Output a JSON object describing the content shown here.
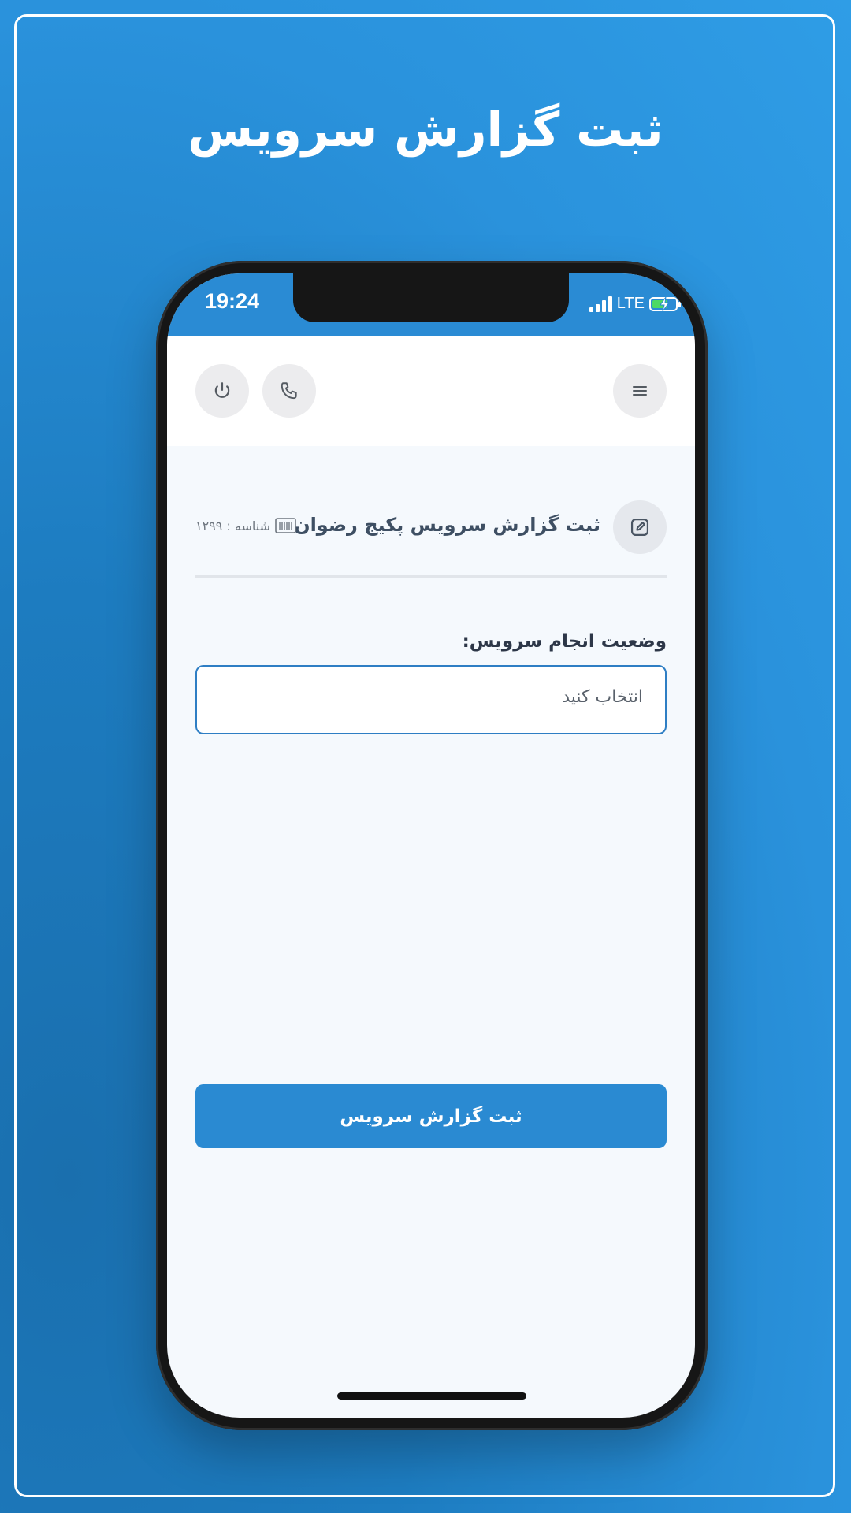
{
  "promo": {
    "title": "ثبت گزارش سرویس"
  },
  "status_bar": {
    "time": "19:24",
    "network": "LTE",
    "icons": [
      "signal-icon",
      "battery-charging-icon"
    ]
  },
  "header": {
    "buttons": [
      "power-icon",
      "phone-icon",
      "menu-icon"
    ]
  },
  "report": {
    "title": "ثبت گزارش سرویس پکیج رضوان",
    "id_text": "شناسه : ۱۲۹۹",
    "icons": [
      "edit-icon",
      "barcode-icon"
    ]
  },
  "form": {
    "status_label": "وضعیت انجام سرویس:",
    "status_value": "انتخاب کنید",
    "submit_label": "ثبت گزارش سرویس"
  },
  "colors": {
    "background": "#2a92dc",
    "accent": "#2a8ad2",
    "status_bar": "#2a8bd4",
    "screen": "#f5f9fd"
  }
}
